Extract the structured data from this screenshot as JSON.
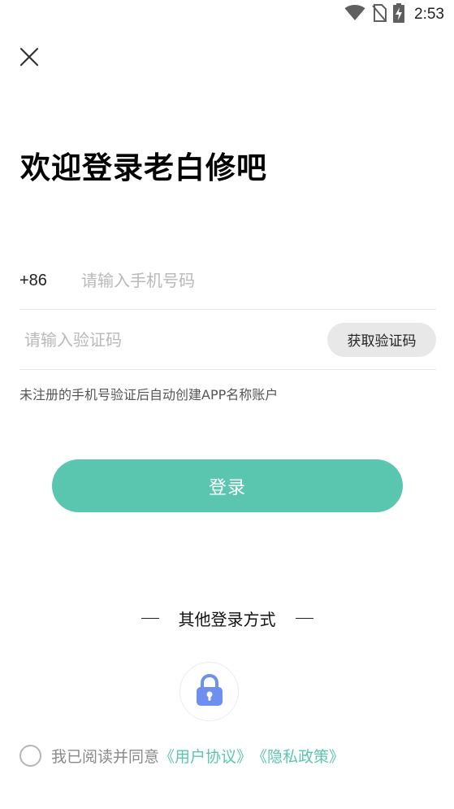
{
  "status_bar": {
    "time": "2:53",
    "icons": [
      "wifi-icon",
      "no-sim-icon",
      "battery-charging-icon"
    ]
  },
  "header": {
    "close_icon": "close-icon",
    "title": "欢迎登录老白修吧"
  },
  "form": {
    "country_code": "+86",
    "phone_placeholder": "请输入手机号码",
    "code_placeholder": "请输入验证码",
    "get_code_label": "获取验证码",
    "hint": "未注册的手机号验证后自动创建APP名称账户"
  },
  "login_button": {
    "label": "登录"
  },
  "other_login": {
    "label": "其他登录方式",
    "lock_icon": "lock-icon"
  },
  "agreement": {
    "text": "我已阅读并同意",
    "user_agreement": "《用户协议》",
    "privacy_policy": "《隐私政策》"
  },
  "colors": {
    "accent": "#5bc6b0",
    "lock_icon": "#6f8ff0",
    "get_code_bg": "#e8e8e8"
  }
}
